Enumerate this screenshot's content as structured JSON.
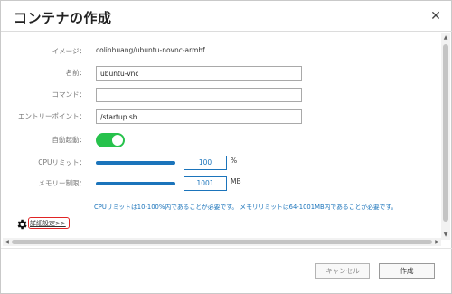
{
  "dialog": {
    "title": "コンテナの作成",
    "close_glyph": "✕"
  },
  "form": {
    "image": {
      "label": "イメージ：",
      "value": "colinhuang/ubuntu-novnc-armhf"
    },
    "name": {
      "label": "名前：",
      "value": "ubuntu-vnc"
    },
    "command": {
      "label": "コマンド：",
      "value": ""
    },
    "entrypoint": {
      "label": "エントリーポイント：",
      "value": "/startup.sh"
    },
    "autostart": {
      "label": "自動起動：",
      "enabled": true
    },
    "cpu_limit": {
      "label": "CPUリミット：",
      "value": "100",
      "unit": "%"
    },
    "memory_limit": {
      "label": "メモリー制限：",
      "value": "1001",
      "unit": "MB"
    },
    "info_text": "CPUリミットは10-100%内であることが必要です。 メモリリミットは64-1001MB内であることが必要です。"
  },
  "advanced": {
    "label": "詳細設定>>"
  },
  "footer": {
    "cancel_label": "キャンセル",
    "create_label": "作成"
  },
  "colors": {
    "accent": "#1b74bb",
    "toggle_on": "#27c24c",
    "highlight": "#e02424"
  },
  "icons": {
    "gear": "gear-icon",
    "close": "close-icon"
  }
}
